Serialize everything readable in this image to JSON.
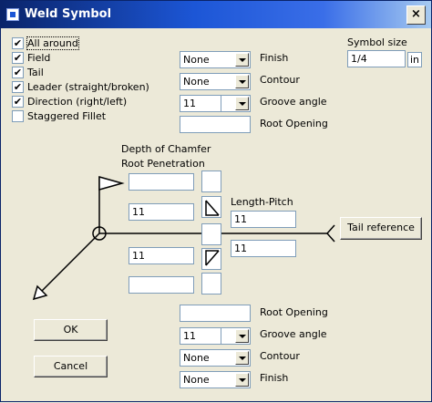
{
  "window": {
    "title": "Weld Symbol",
    "close_glyph": "×"
  },
  "options": [
    {
      "label": "All around",
      "checked": true
    },
    {
      "label": "Field",
      "checked": true
    },
    {
      "label": "Tail",
      "checked": true
    },
    {
      "label": "Leader (straight/broken)",
      "checked": true
    },
    {
      "label": "Direction (right/left)",
      "checked": true
    },
    {
      "label": "Staggered Fillet",
      "checked": false
    }
  ],
  "symbol_size": {
    "label": "Symbol size",
    "value": "1/4",
    "unit": "in"
  },
  "arrow_side": {
    "finish": {
      "label": "Finish",
      "value": "None"
    },
    "contour": {
      "label": "Contour",
      "value": "None"
    },
    "groove_angle": {
      "label": "Groove angle",
      "value": "11"
    },
    "root_opening": {
      "label": "Root Opening",
      "value": ""
    }
  },
  "other_side": {
    "root_opening": {
      "label": "Root Opening",
      "value": ""
    },
    "groove_angle": {
      "label": "Groove angle",
      "value": "11"
    },
    "contour": {
      "label": "Contour",
      "value": "None"
    },
    "finish": {
      "label": "Finish",
      "value": "None"
    }
  },
  "depth_labels": {
    "depth_of_chamfer": "Depth of Chamfer",
    "root_penetration": "Root Penetration"
  },
  "length_pitch": {
    "label": "Length-Pitch",
    "top_value": "11",
    "bottom_value": "11"
  },
  "weld_fields": {
    "top_upper": "",
    "top_size": "11",
    "bottom_size": "11",
    "bottom_lower": ""
  },
  "buttons": {
    "tail_reference": "Tail reference",
    "ok": "OK",
    "cancel": "Cancel"
  },
  "check_glyph": "✔"
}
